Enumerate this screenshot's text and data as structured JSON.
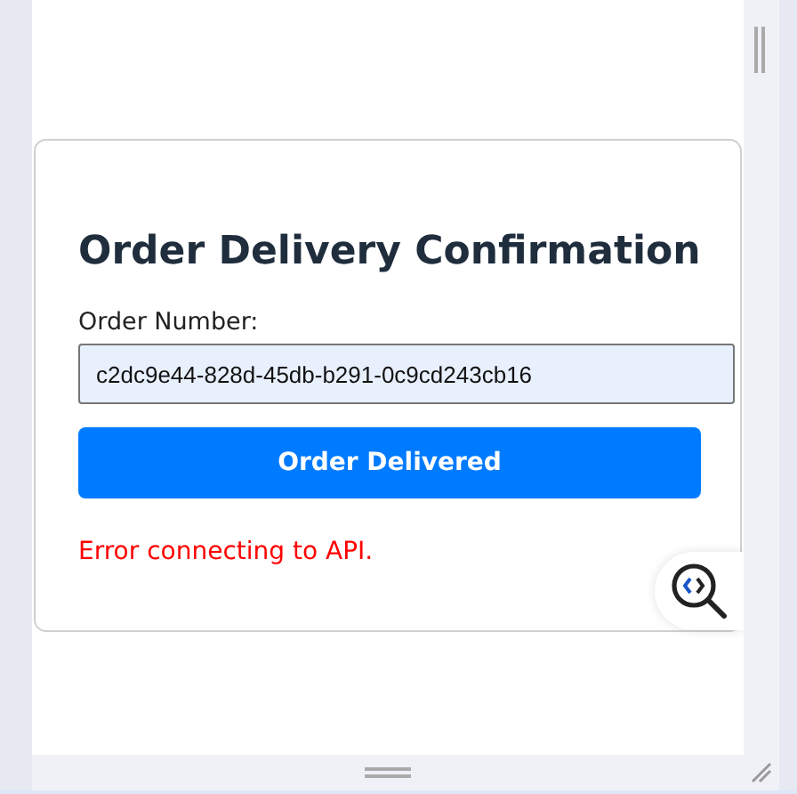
{
  "card": {
    "title": "Order Delivery Confirmation",
    "field": {
      "label": "Order Number:",
      "value": "c2dc9e44-828d-45db-b291-0c9cd243cb16"
    },
    "button": {
      "label": "Order Delivered"
    },
    "error": "Error connecting to API."
  }
}
